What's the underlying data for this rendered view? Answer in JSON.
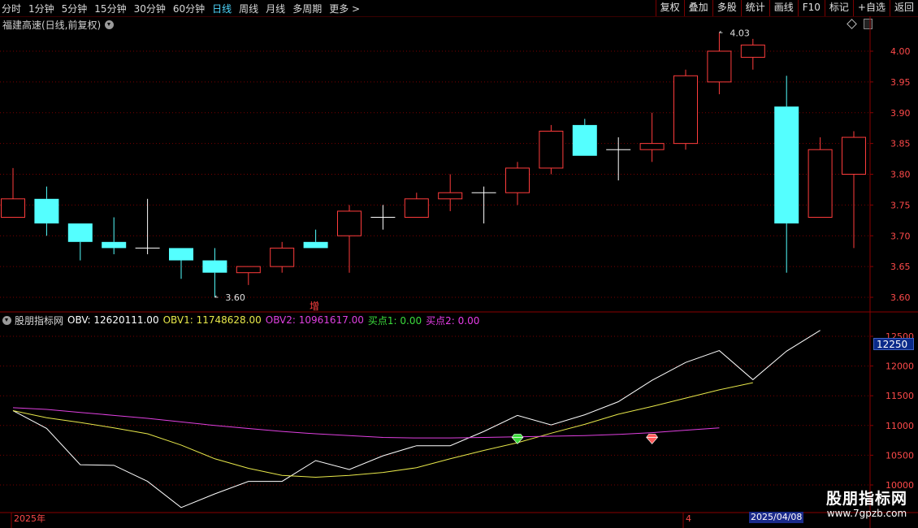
{
  "toolbar": {
    "periods": [
      "分时",
      "1分钟",
      "5分钟",
      "15分钟",
      "30分钟",
      "60分钟",
      "日线",
      "周线",
      "月线",
      "多周期",
      "更多 >"
    ],
    "active_period": "日线",
    "right_buttons": [
      "复权",
      "叠加",
      "多股",
      "统计",
      "画线",
      "F10",
      "标记",
      "+自选",
      "返回"
    ]
  },
  "chart_title": "福建高速(日线,前复权)",
  "indicator": {
    "name": "股朋指标网",
    "obv": "OBV: 12620111.00",
    "obv1": "OBV1: 11748628.00",
    "obv2": "OBV2: 10961617.00",
    "buy1": "买点1: 0.00",
    "buy2": "买点2: 0.00",
    "current_value": "12250"
  },
  "colors": {
    "up": "#ff3c3c",
    "down": "#54ffff",
    "doji": "#ffffff",
    "grid": "#7a0000",
    "obv": "#ffffff",
    "obv1": "#e8e84a",
    "obv2": "#e040e0",
    "buy1": "#3cdc3c",
    "buy2": "#e83ce8"
  },
  "marker_zeng": "增",
  "x_axis": {
    "start": "2025年",
    "mid": "4",
    "cursor_date": "2025/04/08"
  },
  "logo": {
    "title": "股朋指标网",
    "url": "www.7gpzb.com"
  },
  "chart_data": [
    {
      "type": "candlestick",
      "title": "福建高速(日线,前复权)",
      "ylim": [
        3.58,
        4.06
      ],
      "yticks": [
        "3.60",
        "3.65",
        "3.70",
        "3.75",
        "3.80",
        "3.85",
        "3.90",
        "3.95",
        "4.00"
      ],
      "candles": [
        {
          "o": 3.73,
          "c": 3.76,
          "h": 3.81,
          "l": 3.73
        },
        {
          "o": 3.76,
          "c": 3.72,
          "h": 3.78,
          "l": 3.7
        },
        {
          "o": 3.72,
          "c": 3.69,
          "h": 3.72,
          "l": 3.66
        },
        {
          "o": 3.69,
          "c": 3.68,
          "h": 3.73,
          "l": 3.67
        },
        {
          "o": 3.68,
          "c": 3.68,
          "h": 3.76,
          "l": 3.67
        },
        {
          "o": 3.68,
          "c": 3.66,
          "h": 3.68,
          "l": 3.63
        },
        {
          "o": 3.66,
          "c": 3.64,
          "h": 3.68,
          "l": 3.6
        },
        {
          "o": 3.64,
          "c": 3.65,
          "h": 3.65,
          "l": 3.62
        },
        {
          "o": 3.65,
          "c": 3.68,
          "h": 3.69,
          "l": 3.64
        },
        {
          "o": 3.69,
          "c": 3.68,
          "h": 3.71,
          "l": 3.68
        },
        {
          "o": 3.7,
          "c": 3.74,
          "h": 3.75,
          "l": 3.64
        },
        {
          "o": 3.73,
          "c": 3.73,
          "h": 3.75,
          "l": 3.71
        },
        {
          "o": 3.73,
          "c": 3.76,
          "h": 3.77,
          "l": 3.73
        },
        {
          "o": 3.76,
          "c": 3.77,
          "h": 3.8,
          "l": 3.74
        },
        {
          "o": 3.77,
          "c": 3.77,
          "h": 3.78,
          "l": 3.72
        },
        {
          "o": 3.77,
          "c": 3.81,
          "h": 3.82,
          "l": 3.75
        },
        {
          "o": 3.81,
          "c": 3.87,
          "h": 3.88,
          "l": 3.8
        },
        {
          "o": 3.88,
          "c": 3.83,
          "h": 3.89,
          "l": 3.83
        },
        {
          "o": 3.84,
          "c": 3.84,
          "h": 3.86,
          "l": 3.79
        },
        {
          "o": 3.84,
          "c": 3.85,
          "h": 3.9,
          "l": 3.82
        },
        {
          "o": 3.85,
          "c": 3.96,
          "h": 3.97,
          "l": 3.84
        },
        {
          "o": 3.95,
          "c": 4.0,
          "h": 4.03,
          "l": 3.93
        },
        {
          "o": 3.99,
          "c": 4.01,
          "h": 4.02,
          "l": 3.97
        },
        {
          "o": 3.91,
          "c": 3.72,
          "h": 3.96,
          "l": 3.64
        },
        {
          "o": 3.73,
          "c": 3.84,
          "h": 3.86,
          "l": 3.73
        },
        {
          "o": 3.8,
          "c": 3.86,
          "h": 3.87,
          "l": 3.68
        }
      ],
      "annotations": [
        {
          "label": "3.60",
          "index": 6,
          "value": 3.6
        },
        {
          "label": "4.03",
          "index": 21,
          "value": 4.03
        }
      ]
    },
    {
      "type": "line",
      "ylim": [
        10000,
        12700
      ],
      "yticks": [
        "10000",
        "10500",
        "11000",
        "11500",
        "12000",
        "12500"
      ],
      "series": [
        {
          "name": "OBV",
          "values": [
            11250,
            10950,
            10340,
            10330,
            10060,
            9620,
            9850,
            10060,
            10060,
            10410,
            10260,
            10490,
            10660,
            10660,
            10900,
            11170,
            11010,
            11180,
            11400,
            11760,
            12060,
            12260,
            11770,
            12250,
            12600
          ]
        },
        {
          "name": "OBV1",
          "values": [
            11250,
            11130,
            11050,
            10960,
            10860,
            10670,
            10440,
            10280,
            10160,
            10130,
            10160,
            10210,
            10290,
            10440,
            10580,
            10710,
            10870,
            11020,
            11190,
            11320,
            11460,
            11600,
            11720
          ]
        },
        {
          "name": "OBV2",
          "values": [
            11300,
            11270,
            11220,
            11170,
            11120,
            11060,
            11000,
            10950,
            10900,
            10860,
            10830,
            10800,
            10790,
            10790,
            10800,
            10810,
            10820,
            10830,
            10850,
            10880,
            10920,
            10960
          ]
        }
      ],
      "buy_points": [
        {
          "name": "买点1",
          "index": 15,
          "value": 10760
        },
        {
          "name": "买点2",
          "index": 19,
          "value": 10760
        }
      ]
    }
  ]
}
